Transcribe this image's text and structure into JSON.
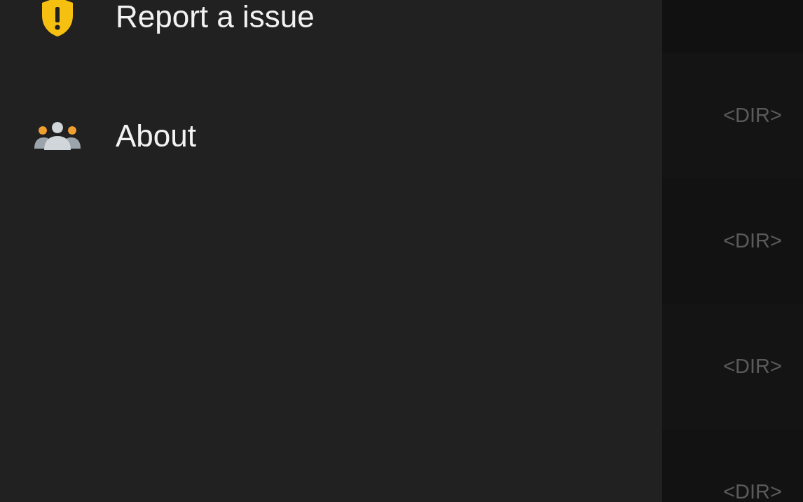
{
  "drawer": {
    "items": [
      {
        "kind": "report",
        "label": "Report a issue"
      },
      {
        "kind": "about",
        "label": "About"
      }
    ]
  },
  "file_list": {
    "rows": [
      {
        "size": "<DIR>"
      },
      {
        "size": "<DIR>"
      },
      {
        "size": "<DIR>"
      },
      {
        "size": "<DIR>"
      }
    ]
  }
}
